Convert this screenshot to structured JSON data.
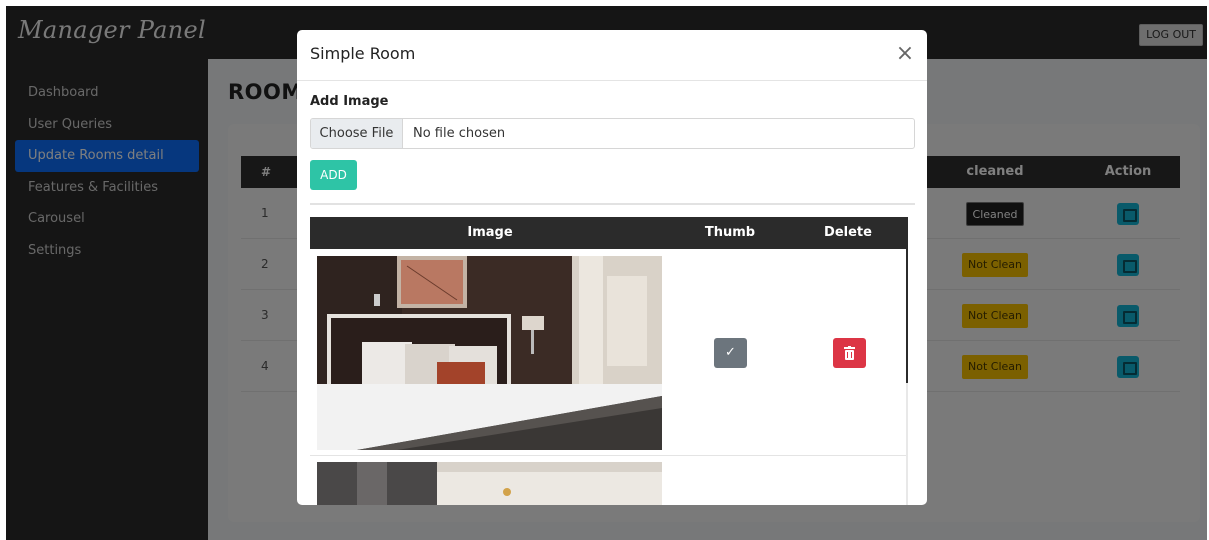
{
  "app": {
    "brand": "Manager Panel",
    "logout_label": "LOG OUT"
  },
  "sidebar": {
    "items": [
      {
        "label": "Dashboard",
        "active": false
      },
      {
        "label": "User Queries",
        "active": false
      },
      {
        "label": "Update Rooms detail",
        "active": true
      },
      {
        "label": "Features & Facilities",
        "active": false
      },
      {
        "label": "Carousel",
        "active": false
      },
      {
        "label": "Settings",
        "active": false
      }
    ]
  },
  "main": {
    "page_title": "ROOMS",
    "table": {
      "headers": {
        "num": "#",
        "cleaned": "cleaned",
        "action": "Action"
      },
      "rows": [
        {
          "num": "1",
          "cleaned": "Cleaned",
          "status": "dark"
        },
        {
          "num": "2",
          "cleaned": "Not Clean",
          "status": "warn"
        },
        {
          "num": "3",
          "cleaned": "Not Clean",
          "status": "warn"
        },
        {
          "num": "4",
          "cleaned": "Not Clean",
          "status": "warn"
        }
      ]
    }
  },
  "modal": {
    "title": "Simple Room",
    "close_icon": "close-icon",
    "add_image_label": "Add Image",
    "choose_file_label": "Choose File",
    "file_status": "No file chosen",
    "add_button": "ADD",
    "image_table": {
      "headers": {
        "image": "Image",
        "thumb": "Thumb",
        "delete": "Delete"
      }
    }
  },
  "colors": {
    "active_nav": "#0d6efd",
    "add_button": "#2ec4a6",
    "delete_button": "#dc3545",
    "thumb_button": "#6c757d",
    "badge_warning": "#f6c000",
    "action_button": "#13b4d4"
  }
}
